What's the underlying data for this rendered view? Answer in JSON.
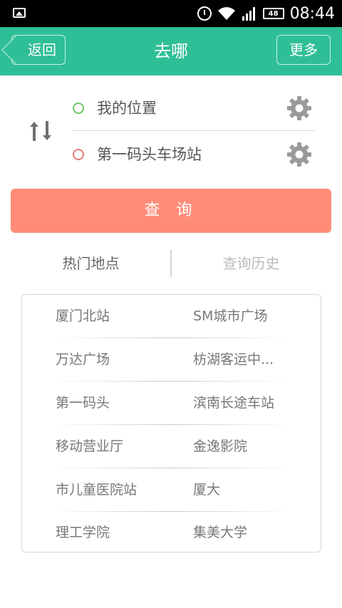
{
  "status_bar": {
    "time": "08:44",
    "battery": "48"
  },
  "header": {
    "title": "去哪",
    "back_label": "返回",
    "more_label": "更多"
  },
  "route": {
    "from": "我的位置",
    "to": "第一码头车场站"
  },
  "query_button": "查 询",
  "tabs": {
    "hot": "热门地点",
    "history": "查询历史"
  },
  "places": [
    [
      "厦门北站",
      "SM城市广场"
    ],
    [
      "万达广场",
      "枋湖客运中..."
    ],
    [
      "第一码头",
      "滨南长途车站"
    ],
    [
      "移动营业厅",
      "金逸影院"
    ],
    [
      "市儿童医院站",
      "厦大"
    ],
    [
      "理工学院",
      "集美大学"
    ]
  ],
  "colors": {
    "header": "#2fbf97",
    "query_button": "#ff8c78",
    "from_dot": "#6cc868",
    "to_dot": "#e57a78"
  }
}
